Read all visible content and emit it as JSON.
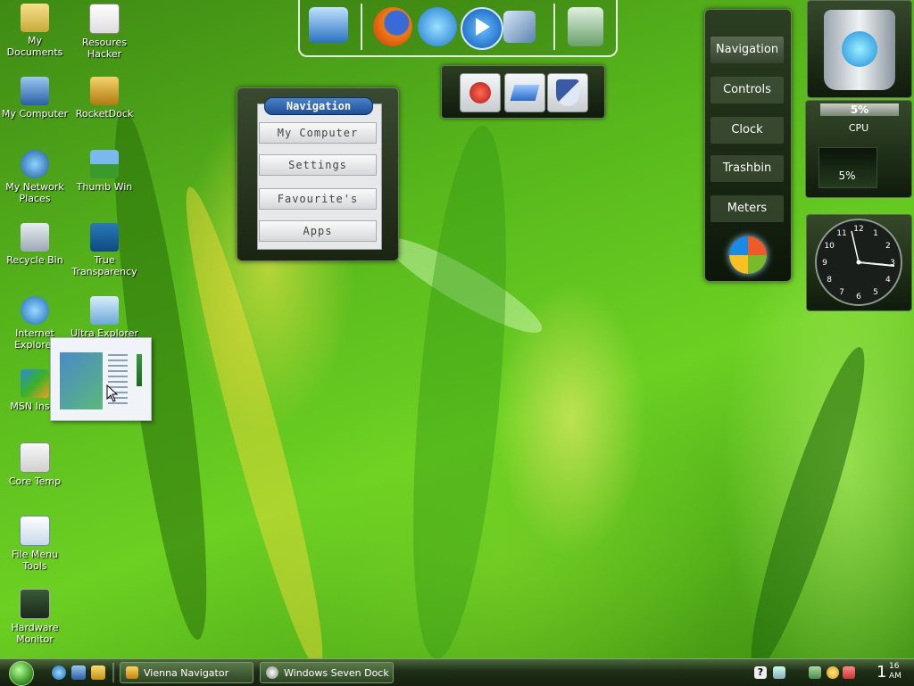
{
  "desktop": {
    "icons": [
      {
        "label": "My Documents",
        "icon": "folder-documents-icon"
      },
      {
        "label": "Resoures\nHacker",
        "icon": "resource-hacker-icon"
      },
      {
        "label": "My Computer",
        "icon": "computer-icon"
      },
      {
        "label": "RocketDock",
        "icon": "rocketdock-icon"
      },
      {
        "label": "My Network\nPlaces",
        "icon": "network-places-icon"
      },
      {
        "label": "Thumb Win",
        "icon": "thumb-win-icon"
      },
      {
        "label": "Recycle Bin",
        "icon": "recycle-bin-icon"
      },
      {
        "label": "True\nTransparency",
        "icon": "true-transparency-icon"
      },
      {
        "label": "Internet\nExplorer",
        "icon": "internet-explorer-icon"
      },
      {
        "label": "Ultra Explorer",
        "icon": "ultra-explorer-icon"
      },
      {
        "label": "MSN Insta",
        "icon": "msn-icon"
      },
      {
        "label": "Core Temp",
        "icon": "core-temp-icon"
      },
      {
        "label": "File Menu Tools",
        "icon": "file-menu-tools-icon"
      },
      {
        "label": "Hardware\nMonitor",
        "icon": "hardware-monitor-icon"
      }
    ]
  },
  "dock": {
    "items": [
      "monitor-icon",
      "firefox-icon",
      "internet-explorer-icon",
      "media-player-icon",
      "control-panel-icon",
      "trash-icon"
    ]
  },
  "nav_popup": {
    "title": "Navigation",
    "buttons": [
      "My Computer",
      "Settings",
      "Favourite's",
      "Apps"
    ]
  },
  "right_panel": {
    "buttons": [
      "Navigation",
      "Controls",
      "Clock",
      "Trashbin",
      "Meters"
    ],
    "logo": "windows-orb-icon"
  },
  "cpu_meter": {
    "top_value": "5%",
    "label": "CPU",
    "bar_value": "5%",
    "level": 0.05
  },
  "clock_widget": {
    "numbers": [
      "12",
      "1",
      "2",
      "3",
      "4",
      "5",
      "6",
      "7",
      "8",
      "9",
      "10",
      "11"
    ]
  },
  "taskbar": {
    "tasks": [
      {
        "label": "Vienna Navigator",
        "icon": "vienna-icon"
      },
      {
        "label": "Windows Seven Dock",
        "icon": "dock-icon"
      }
    ],
    "clock_hour": "1",
    "clock_min": "16",
    "clock_ampm": "AM"
  },
  "colors": {
    "accent_blue": "#1d4f96",
    "panel_dark": "#1a2412",
    "taskbar": "#1e2e16"
  }
}
